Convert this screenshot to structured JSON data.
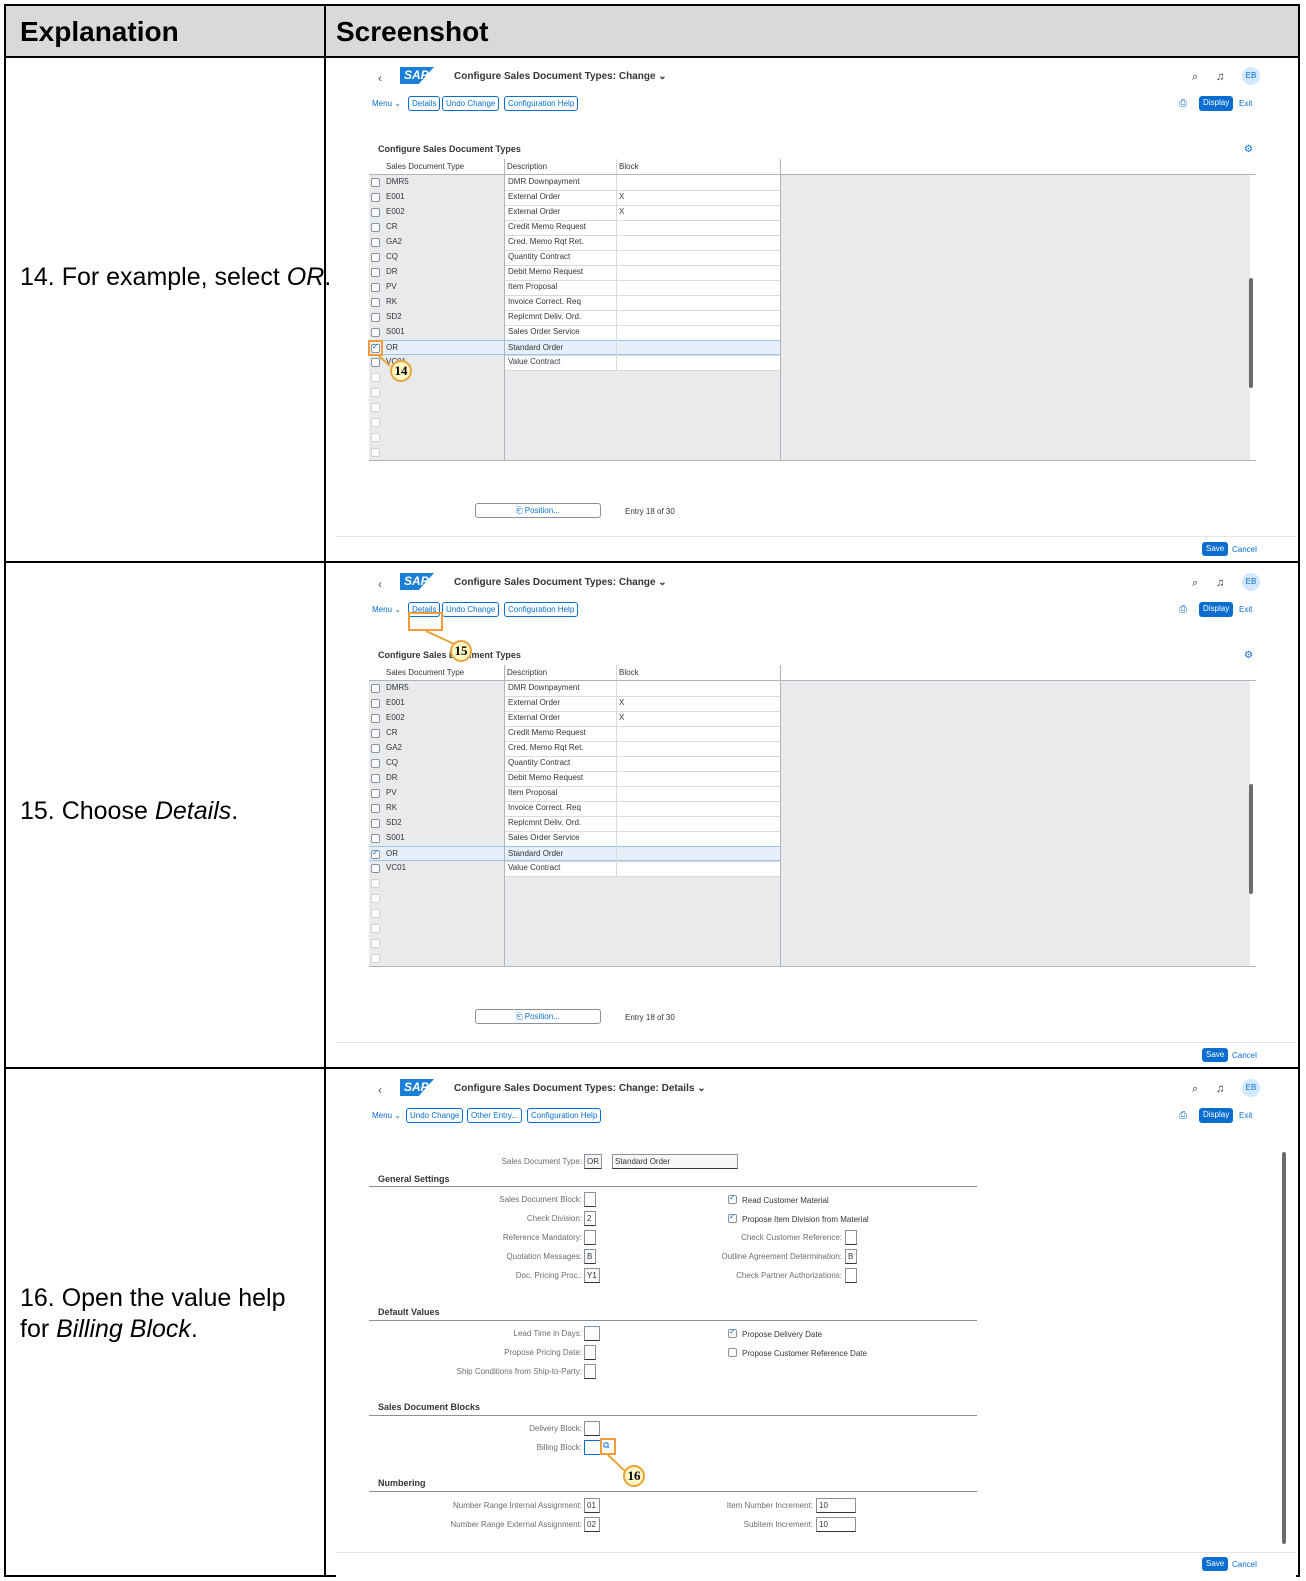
{
  "headers": {
    "explanation": "Explanation",
    "screenshot": "Screenshot"
  },
  "steps": [
    {
      "text_parts": [
        "14. For example, select ",
        "OR",
        "."
      ]
    },
    {
      "text_parts": [
        "15. Choose ",
        "Details",
        "."
      ]
    },
    {
      "text_parts": [
        "16. Open the value help for ",
        "Billing Block",
        "."
      ]
    }
  ],
  "shell": {
    "app_title_list": "Configure Sales Document Types: Change",
    "app_title_details": "Configure Sales Document Types: Change: Details",
    "logo": "SAP",
    "avatar": "EB",
    "menu": "Menu",
    "display": "Display",
    "exit": "Exit",
    "save": "Save",
    "cancel": "Cancel"
  },
  "toolbar_list": [
    "Details",
    "Undo Change",
    "Configuration Help"
  ],
  "toolbar_details": [
    "Undo Change",
    "Other Entry...",
    "Configuration Help"
  ],
  "table": {
    "title": "Configure Sales Document Types",
    "columns": [
      "Sales Document Type",
      "Description",
      "Block"
    ],
    "rows": [
      {
        "type": "DMR5",
        "desc": "DMR Downpayment",
        "block": "",
        "checked": false
      },
      {
        "type": "E001",
        "desc": "External Order",
        "block": "X",
        "checked": false
      },
      {
        "type": "E002",
        "desc": "External Order",
        "block": "X",
        "checked": false
      },
      {
        "type": "CR",
        "desc": "Credit Memo Request",
        "block": "",
        "checked": false
      },
      {
        "type": "GA2",
        "desc": "Cred. Memo Rqt Ret.",
        "block": "",
        "checked": false
      },
      {
        "type": "CQ",
        "desc": "Quantity Contract",
        "block": "",
        "checked": false
      },
      {
        "type": "DR",
        "desc": "Debit Memo Request",
        "block": "",
        "checked": false
      },
      {
        "type": "PV",
        "desc": "Item Proposal",
        "block": "",
        "checked": false
      },
      {
        "type": "RK",
        "desc": "Invoice Correct. Req",
        "block": "",
        "checked": false
      },
      {
        "type": "SD2",
        "desc": "Replcmnt Deliv. Ord.",
        "block": "",
        "checked": false
      },
      {
        "type": "S001",
        "desc": "Sales Order Service",
        "block": "",
        "checked": false
      },
      {
        "type": "OR",
        "desc": "Standard Order",
        "block": "",
        "checked": true
      },
      {
        "type": "VC01",
        "desc": "Value Contract",
        "block": "",
        "checked": false
      }
    ],
    "position_button": "Position...",
    "entry": "Entry 18 of 30"
  },
  "callouts": {
    "c14": "14",
    "c15": "15",
    "c16": "16"
  },
  "details": {
    "doc_type_label": "Sales Document Type:",
    "doc_type_value": "OR",
    "doc_type_desc": "Standard Order",
    "general": {
      "title": "General Settings",
      "left": [
        {
          "label": "Sales Document Block:",
          "value": ""
        },
        {
          "label": "Check Division:",
          "value": "2"
        },
        {
          "label": "Reference Mandatory:",
          "value": ""
        },
        {
          "label": "Quotation Messages:",
          "value": "B"
        },
        {
          "label": "Doc. Pricing Proc.:",
          "value": "Y1"
        }
      ],
      "right_checks": [
        {
          "label": "Read Customer Material",
          "checked": true
        },
        {
          "label": "Propose Item Division from Material",
          "checked": true
        }
      ],
      "right_fields": [
        {
          "label": "Check Customer Reference:",
          "value": ""
        },
        {
          "label": "Outline Agreement Determination:",
          "value": "B"
        },
        {
          "label": "Check Partner Authorizations:",
          "value": ""
        }
      ]
    },
    "defaults": {
      "title": "Default Values",
      "left": [
        {
          "label": "Lead Time in Days:",
          "value": ""
        },
        {
          "label": "Propose Pricing Date:",
          "value": ""
        },
        {
          "label": "Ship Conditions from Ship-to-Party:",
          "value": ""
        }
      ],
      "right_checks": [
        {
          "label": "Propose Delivery Date",
          "checked": true
        },
        {
          "label": "Propose Customer Reference Date",
          "checked": false
        }
      ]
    },
    "blocks": {
      "title": "Sales Document Blocks",
      "left": [
        {
          "label": "Delivery Block:",
          "value": ""
        },
        {
          "label": "Billing Block:",
          "value": ""
        }
      ]
    },
    "numbering": {
      "title": "Numbering",
      "left": [
        {
          "label": "Number Range Internal Assignment:",
          "value": "01"
        },
        {
          "label": "Number Range External Assignment:",
          "value": "02"
        }
      ],
      "right": [
        {
          "label": "Item Number Increment:",
          "value": "10"
        },
        {
          "label": "Subitem Increment:",
          "value": "10"
        }
      ]
    }
  }
}
